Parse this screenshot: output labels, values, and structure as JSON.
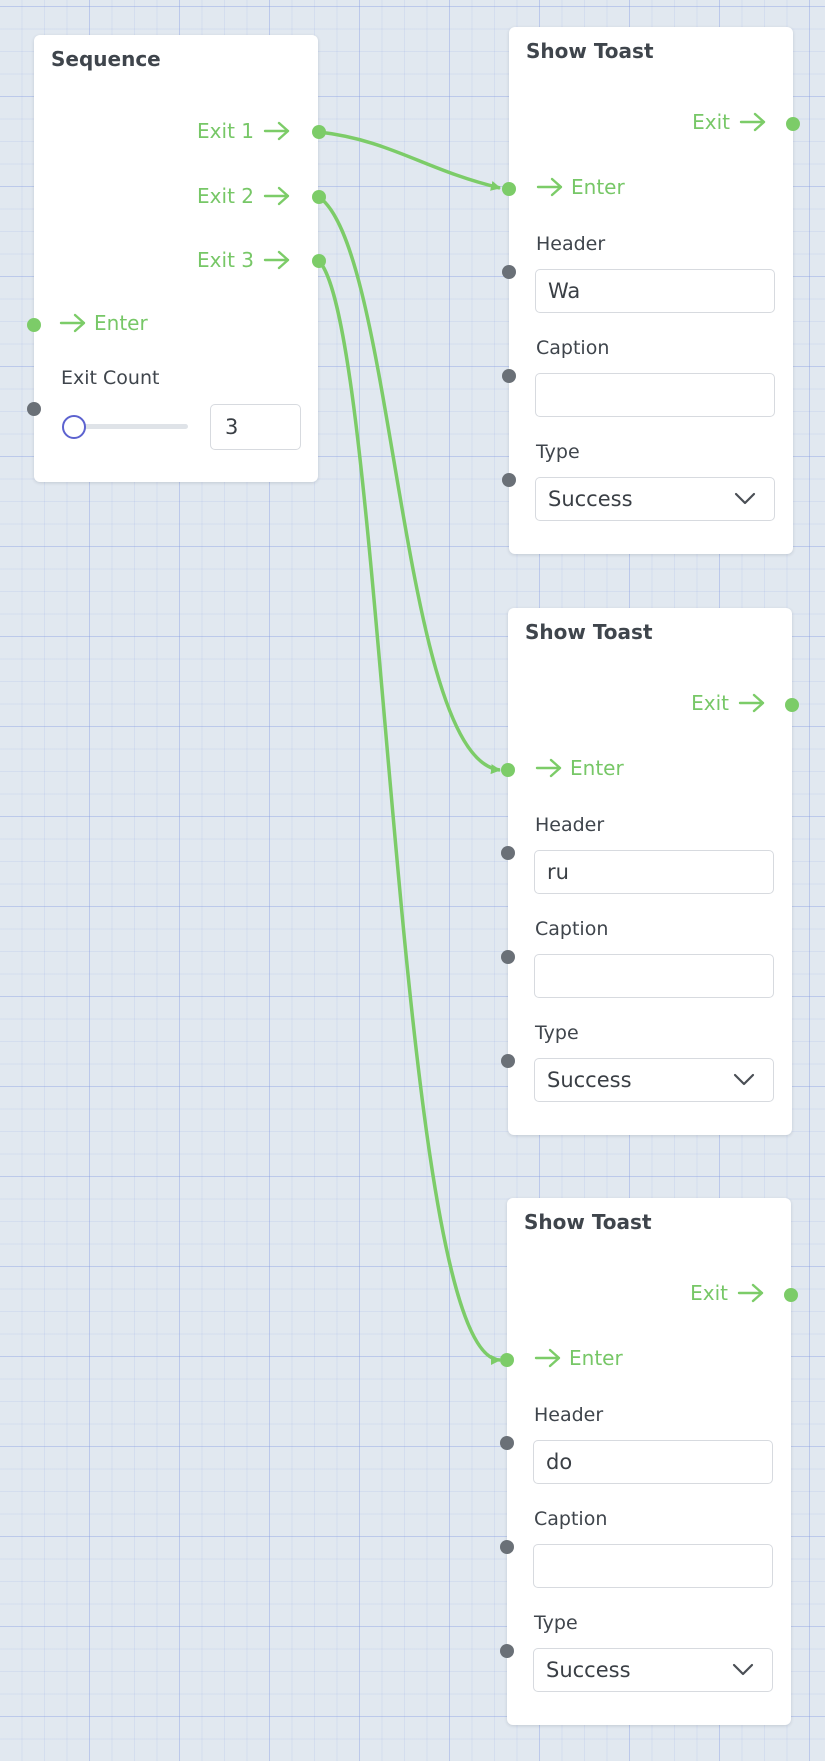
{
  "colors": {
    "port_green": "#7ccc68",
    "port_grey": "#6a7077",
    "wire": "#7ccc68",
    "slider_accent": "#5c62cf"
  },
  "sequence_node": {
    "title": "Sequence",
    "exits": [
      "Exit 1",
      "Exit 2",
      "Exit 3"
    ],
    "enter_label": "Enter",
    "exit_count_label": "Exit Count",
    "exit_count_value": "3",
    "slider_value_fraction": 0.0
  },
  "toast_nodes": [
    {
      "title": "Show Toast",
      "exit_label": "Exit",
      "enter_label": "Enter",
      "header_label": "Header",
      "header_value": "Wa",
      "caption_label": "Caption",
      "caption_value": "",
      "type_label": "Type",
      "type_value": "Success"
    },
    {
      "title": "Show Toast",
      "exit_label": "Exit",
      "enter_label": "Enter",
      "header_label": "Header",
      "header_value": "ru",
      "caption_label": "Caption",
      "caption_value": "",
      "type_label": "Type",
      "type_value": "Success"
    },
    {
      "title": "Show Toast",
      "exit_label": "Exit",
      "enter_label": "Enter",
      "header_label": "Header",
      "header_value": "do",
      "caption_label": "Caption",
      "caption_value": "",
      "type_label": "Type",
      "type_value": "Success"
    }
  ]
}
